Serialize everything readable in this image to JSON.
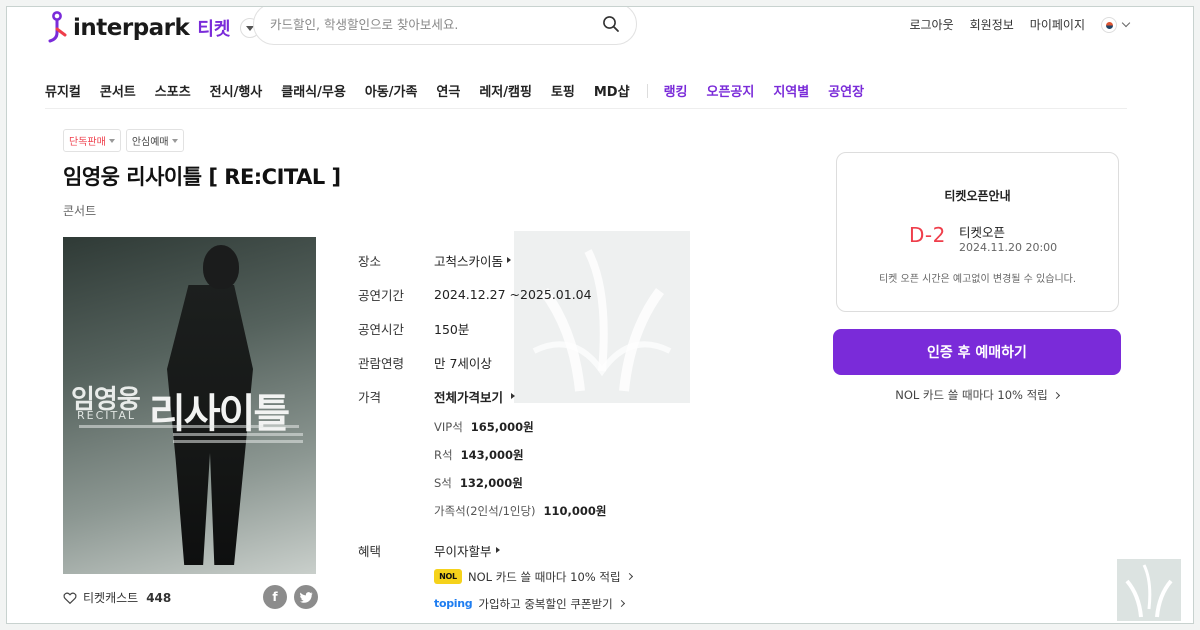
{
  "header": {
    "logo_text": "interpark",
    "logo_suffix": "티켓",
    "search_placeholder": "카드할인, 학생할인으로 찾아보세요.",
    "links": [
      "로그아웃",
      "회원정보",
      "마이페이지"
    ],
    "language_icon": "korea-flag-icon"
  },
  "nav": {
    "items": [
      "뮤지컬",
      "콘서트",
      "스포츠",
      "전시/행사",
      "클래식/무용",
      "아동/가족",
      "연극",
      "레저/캠핑",
      "토핑",
      "MD샵"
    ],
    "highlight_items": [
      "랭킹",
      "오픈공지",
      "지역별",
      "공연장"
    ]
  },
  "product": {
    "badges": [
      "단독판매",
      "안심예매"
    ],
    "title": "임영웅 리사이틀 [ RE:CITAL ]",
    "category": "콘서트",
    "poster": {
      "name_ko": "임영웅",
      "name_en": "RECITAL",
      "recital_ko": "리사이틀"
    },
    "likes_label": "티켓캐스트",
    "likes_count": "448",
    "share": [
      "f",
      "t"
    ]
  },
  "info": {
    "venue_label": "장소",
    "venue": "고척스카이돔",
    "period_label": "공연기간",
    "period": "2024.12.27 ~2025.01.04",
    "runtime_label": "공연시간",
    "runtime": "150분",
    "age_label": "관람연령",
    "age": "만 7세이상",
    "price_label": "가격",
    "price_all": "전체가격보기",
    "prices": [
      {
        "grade": "VIP석",
        "price": "165,000원"
      },
      {
        "grade": "R석",
        "price": "143,000원"
      },
      {
        "grade": "S석",
        "price": "132,000원"
      },
      {
        "grade": "가족석(2인석/1인당)",
        "price": "110,000원"
      }
    ],
    "benefit_label": "혜택",
    "benefit_installment": "무이자할부",
    "benefit_nol": "NOL 카드 쓸 때마다 10% 적립",
    "benefit_toping": "가입하고 중복할인 쿠폰받기",
    "nol_logo": "NOL",
    "toping_logo": "toping"
  },
  "panel": {
    "title": "티켓오픈안내",
    "dday": "D-2",
    "open_label": "티켓오픈",
    "open_date": "2024.11.20 20:00",
    "note": "티켓 오픈 시간은 예고없이 변경될 수 있습니다.",
    "cta": "인증 후 예매하기",
    "nol_line": "NOL 카드 쓸 때마다 10% 적립"
  },
  "colors": {
    "brand_purple": "#7a2bd9",
    "accent_red": "#ef3e4b"
  }
}
